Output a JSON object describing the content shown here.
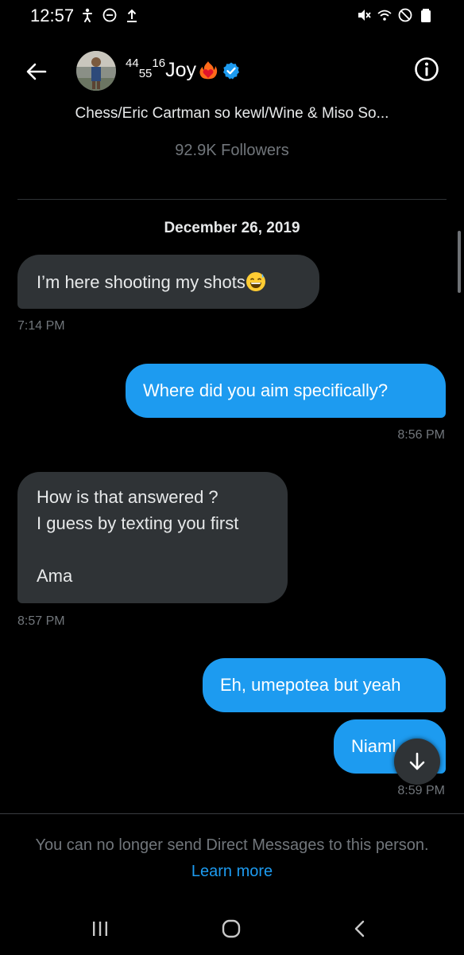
{
  "status_bar": {
    "time": "12:57",
    "left_icons": [
      "accessibility-icon",
      "dnd-icon",
      "upload-icon"
    ],
    "right_icons": [
      "mute-icon",
      "wifi-icon",
      "blocked-icon",
      "battery-icon"
    ]
  },
  "header": {
    "sup_a": "44",
    "sub_b": "55",
    "sup_c": "16",
    "name": "Joy",
    "verified": true,
    "bio": "Chess/Eric Cartman so kewl/Wine & Miso So...",
    "followers": "92.9K Followers"
  },
  "conversation": {
    "date": "December 26, 2019",
    "messages": [
      {
        "direction": "in",
        "text": "I’m here shooting my shots",
        "emoji": "grin-sweat-emoji",
        "time": "7:14 PM"
      },
      {
        "direction": "out",
        "text": "Where did you aim specifically?",
        "time": "8:56 PM"
      },
      {
        "direction": "in",
        "text": "How is that answered ?\nI guess by texting you first\n\nAma",
        "time": "8:57 PM"
      },
      {
        "direction": "out",
        "text": "Eh, umepotea but yeah"
      },
      {
        "direction": "out",
        "text": "Niaml",
        "time": "8:59 PM"
      }
    ]
  },
  "footer": {
    "notice": "You can no longer send Direct Messages to this person.",
    "link": "Learn more"
  },
  "colors": {
    "background": "#000000",
    "accent": "#1d9bf0",
    "incoming_bubble": "#2f3336",
    "secondary_text": "#71767b"
  }
}
